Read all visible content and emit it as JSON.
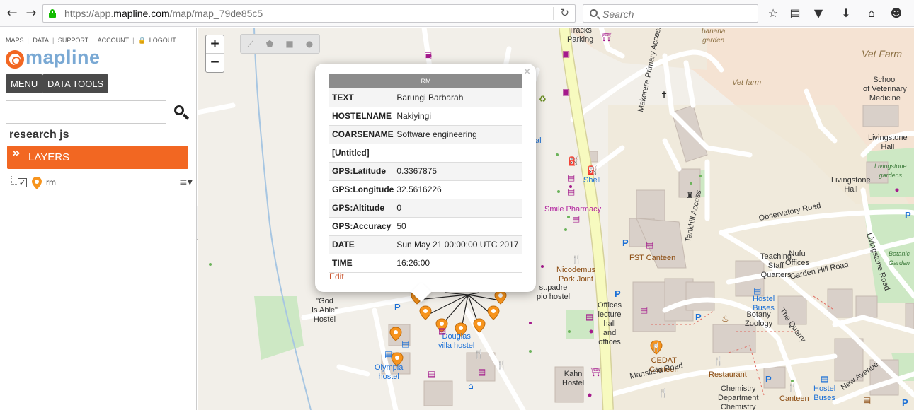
{
  "browser": {
    "url_prefix": "https://app.",
    "url_domain": "mapline.com",
    "url_path": "/map/map_79de85c5",
    "search_placeholder": "Search",
    "icons": [
      "back-icon",
      "forward-icon",
      "lock-icon",
      "reload-icon",
      "search-icon",
      "star-icon",
      "reader-icon",
      "pocket-icon",
      "download-icon",
      "home-icon",
      "emoji-icon"
    ]
  },
  "sidebar": {
    "top_links": [
      "MAPS",
      "DATA",
      "SUPPORT",
      "ACCOUNT",
      "LOGOUT"
    ],
    "logo_text": "mapline",
    "menu_label": "MENU",
    "data_tools_label": "DATA TOOLS",
    "search_value": "",
    "project_name": "research js",
    "layers_label": "LAYERS",
    "layers": [
      {
        "name": "rm",
        "checked": true,
        "check_mark": "✓"
      }
    ]
  },
  "map_controls": {
    "zoom_in": "+",
    "zoom_out": "−"
  },
  "popup": {
    "title": "RM",
    "close": "×",
    "rows": [
      {
        "key": "TEXT",
        "value": "Barungi Barbarah"
      },
      {
        "key": "HOSTELNAME",
        "value": "Nakiyingi"
      },
      {
        "key": "COARSENAME",
        "value": "Software engineering"
      },
      {
        "key": "[Untitled]",
        "value": ""
      },
      {
        "key": "GPS:Latitude",
        "value": "0.3367875"
      },
      {
        "key": "GPS:Longitude",
        "value": "32.5616226"
      },
      {
        "key": "GPS:Altitude",
        "value": "0"
      },
      {
        "key": "GPS:Accuracy",
        "value": "50"
      },
      {
        "key": "DATE",
        "value": "Sun May 21 00:00:00 UTC 2017"
      },
      {
        "key": "TIME",
        "value": "16:26:00"
      }
    ],
    "edit_label": "Edit"
  },
  "map_labels": {
    "tracks_parking": "Tracks\nParking",
    "banana_garden": "banana\ngarden",
    "vet_farm_big": "Vet Farm",
    "vet_farm": "Vet farm",
    "school_vet": "School\nof Veterinary\nMedicine",
    "livingstone_hall": "Livingstone\nHall",
    "livingstone_gardens": "Livingstone\ngardens",
    "livingstone_hall2": "Livingstone\nHall",
    "makerere_access": "Makerere Primary Access",
    "tankhill_access": "Tankhill Access",
    "observatory_road": "Observatory Road",
    "livingstone_road": "Livingstone Road",
    "botanic_garden": "Botanic\nGarden",
    "shell": "Shell",
    "smile_pharmacy": "Smile Pharmacy",
    "fst_canteen": "FST Canteen",
    "teaching_staff": "Teaching\nStaff\nQuarters",
    "nufu_offices": "Nufu\nOffices",
    "garden_hill_road": "Garden Hill Road",
    "nicodemus": "Nicodemus\nPork Joint",
    "st_padre": "st.padre\npio hostel",
    "offices_lecture": "Offices\nlecture\nhall\nand\noffices",
    "god_is_able": "\"God\nIs Able\"\nHostel",
    "douglas_villa": "Douglas\nvilla hostel",
    "olympia_hostel": "Olympia\nhostel",
    "kahn_hostel": "Kahn\nHostel",
    "cedat_canteen": "CEDAT\nCanteen",
    "mansfield_road": "Mansfield Road",
    "hostel_buses": "Hostel\nBuses",
    "botany_zoology": "Botany\nZoology",
    "the_quarry": "The Quarry",
    "restaurant": "Restaurant",
    "chemistry": "Chemistry\nDepartment\nChemistry",
    "canteen": "Canteen",
    "new_avenue": "New Avenue",
    "hostel_buses2": "Hostel\nBuses",
    "al_fragment": "al",
    "p_marker": "P"
  },
  "colors": {
    "accent": "#f26722",
    "logo_blue": "#7aa9d4",
    "dark_button": "#4a4a4a",
    "marker": "#f7941d",
    "major_road": "#f7fabf",
    "campus": "#f0e9dc",
    "farm": "#f5e3d3",
    "park": "#cde8c4",
    "popup_header": "#8c8c8c",
    "edit_link": "#c8532c"
  }
}
